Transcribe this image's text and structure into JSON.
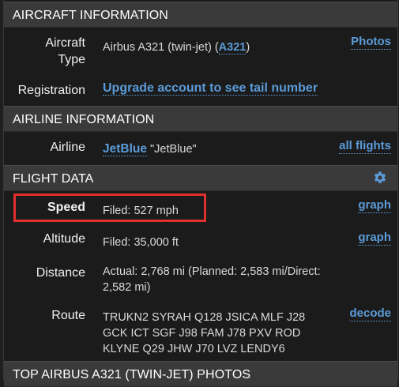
{
  "aircraft_info": {
    "header": "AIRCRAFT INFORMATION",
    "type_label_1": "Aircraft",
    "type_label_2": "Type",
    "type_value": "Airbus A321 (twin-jet) (",
    "type_code": "A321",
    "type_value_end": ")",
    "photos_link": "Photos",
    "registration_label": "Registration",
    "registration_link": "Upgrade account to see tail number"
  },
  "airline_info": {
    "header": "AIRLINE INFORMATION",
    "airline_label": "Airline",
    "airline_link": "JetBlue",
    "airline_name": "\"JetBlue\"",
    "all_flights_link": "all flights"
  },
  "flight_data": {
    "header": "FLIGHT DATA",
    "speed_label": "Speed",
    "speed_value": "Filed: 527 mph",
    "speed_graph": "graph",
    "altitude_label": "Altitude",
    "altitude_value": "Filed: 35,000 ft",
    "altitude_graph": "graph",
    "distance_label": "Distance",
    "distance_value_1": "Actual: 2,768 mi (Planned: 2,583 mi/Direct:",
    "distance_value_2": "2,582 mi)",
    "route_label": "Route",
    "route_line_1": "TRUKN2 SYRAH Q128 JSICA MLF J28",
    "route_line_2": "GCK ICT SGF J98 FAM J78 PXV ROD",
    "route_line_3": "KLYNE Q29 JHW J70 LVZ LENDY6",
    "decode_link": "decode"
  },
  "photos_section": {
    "header": "TOP AIRBUS A321 (TWIN-JET) PHOTOS"
  },
  "colors": {
    "link": "#5b9bd8",
    "highlight": "#e03030",
    "header_bg": "#3a3a3a"
  }
}
